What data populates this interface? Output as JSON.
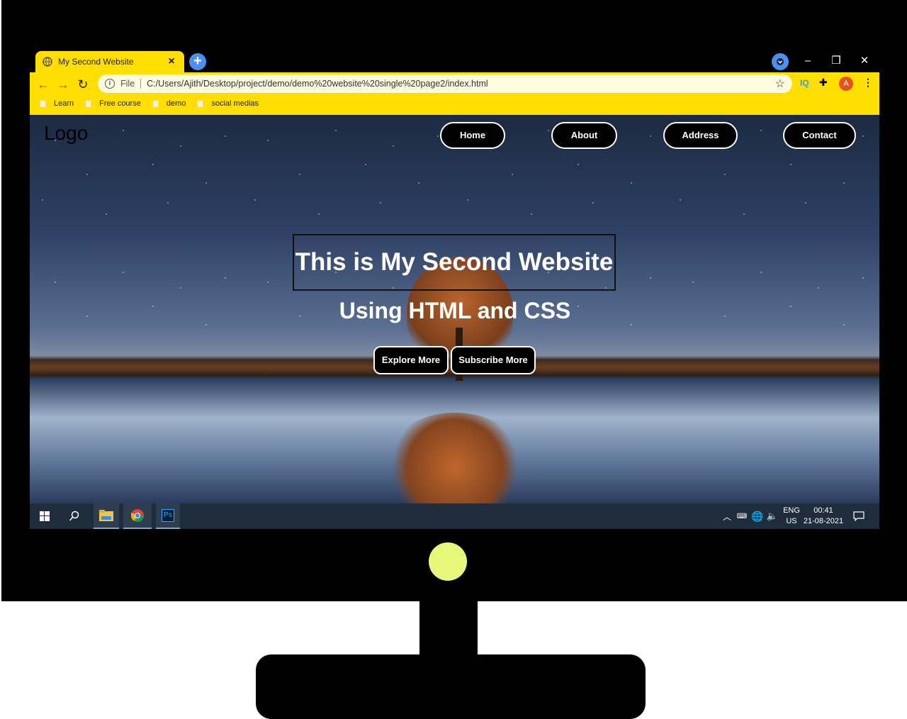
{
  "browser": {
    "tab_title": "My Second Website",
    "tab_close": "×",
    "new_tab": "+",
    "window_controls": {
      "minimize": "–",
      "restore": "❐",
      "close": "✕"
    },
    "url_scheme": "File",
    "url": "C:/Users/Ajith/Desktop/project/demo/demo%20website%20single%20page2/index.html",
    "extensions": {
      "iq": "IQ",
      "avatar_letter": "A"
    },
    "bookmarks": [
      "Learn",
      "Free course",
      "demo",
      "social medias"
    ]
  },
  "page": {
    "logo": "Logo",
    "nav": [
      "Home",
      "About",
      "Address",
      "Contact"
    ],
    "hero_title": "This is My Second Website",
    "hero_subtitle": "Using HTML and CSS",
    "buttons": {
      "explore": "Explore More",
      "subscribe": "Subscribe More"
    }
  },
  "taskbar": {
    "language": "ENG",
    "region": "US",
    "time": "00:41",
    "date": "21-08-2021",
    "ps_label": "Ps"
  },
  "colors": {
    "browser_accent": "#ffde00",
    "power_led": "#e6f87a",
    "new_tab": "#4a8ff2"
  }
}
